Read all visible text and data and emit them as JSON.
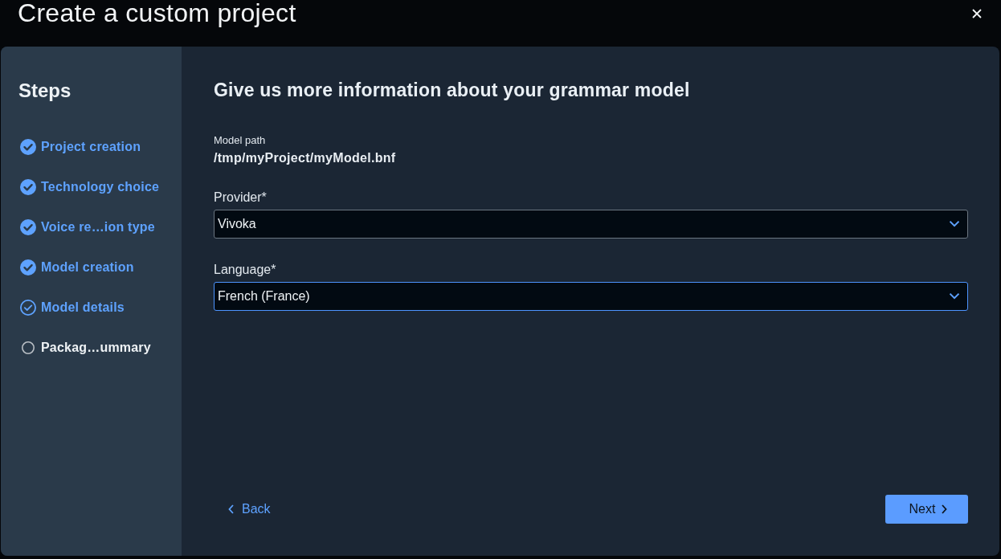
{
  "dialog": {
    "title": "Create a custom project"
  },
  "steps": {
    "title": "Steps",
    "items": [
      {
        "label": "Project creation",
        "completed": true,
        "selected": false
      },
      {
        "label": "Technology choice",
        "completed": true,
        "selected": false
      },
      {
        "label": "Voice re…ion type",
        "completed": true,
        "selected": false
      },
      {
        "label": "Model creation",
        "completed": true,
        "selected": false
      },
      {
        "label": "Model details",
        "completed": true,
        "selected": true
      },
      {
        "label": "Packag…ummary",
        "completed": false,
        "selected": false
      }
    ]
  },
  "form": {
    "heading": "Give us more information about your grammar model",
    "model_path": {
      "label": "Model path",
      "value": "/tmp/myProject/myModel.bnf"
    },
    "fields": [
      {
        "label": "Provider*",
        "value": "Vivoka",
        "focused": false
      },
      {
        "label": "Language*",
        "value": "French (France)",
        "focused": true
      }
    ]
  },
  "buttons": {
    "back": "Back",
    "next": "Next"
  }
}
